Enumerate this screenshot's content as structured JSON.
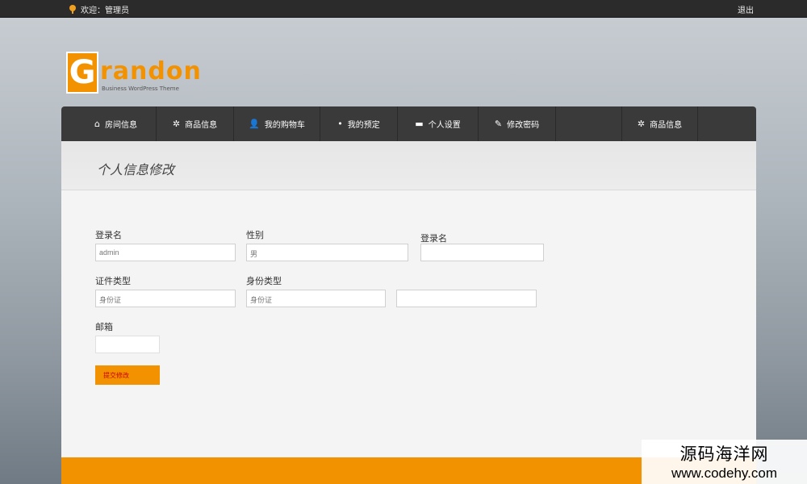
{
  "topbar": {
    "welcome": "欢迎：管理员",
    "logout": "退出"
  },
  "logo": {
    "letter": "G",
    "rest": "randon",
    "tagline": "Business WordPress Theme"
  },
  "nav": [
    {
      "label": "房间信息",
      "icon": "home-icon",
      "glyph": "⌂"
    },
    {
      "label": "商品信息",
      "icon": "gear-icon",
      "glyph": "✲"
    },
    {
      "label": "我的购物车",
      "icon": "user-icon",
      "glyph": "👤"
    },
    {
      "label": "我的预定",
      "icon": "pin-icon",
      "glyph": "•"
    },
    {
      "label": "个人设置",
      "icon": "briefcase-icon",
      "glyph": "▬"
    },
    {
      "label": "修改密码",
      "icon": "pencil-icon",
      "glyph": "✎"
    },
    {
      "label": "商品信息",
      "icon": "gear-icon",
      "glyph": "✲"
    }
  ],
  "page": {
    "title": "个人信息修改"
  },
  "form": {
    "login_label": "登录名",
    "login_value": "admin",
    "gender_label": "性别",
    "gender_value": "男",
    "login2_label": "登录名",
    "id_type_label": "证件类型",
    "id_type_value": "身份证",
    "identity_type_label": "身份类型",
    "identity_type_value": "身份证",
    "email_label": "邮箱",
    "submit_label": "提交修改"
  },
  "watermark": {
    "line1": "源码海洋网",
    "line2": "www.codehy.com"
  },
  "colors": {
    "accent": "#f39200",
    "nav_bg": "#3a3a3a",
    "topbar_bg": "#2b2b2b"
  }
}
